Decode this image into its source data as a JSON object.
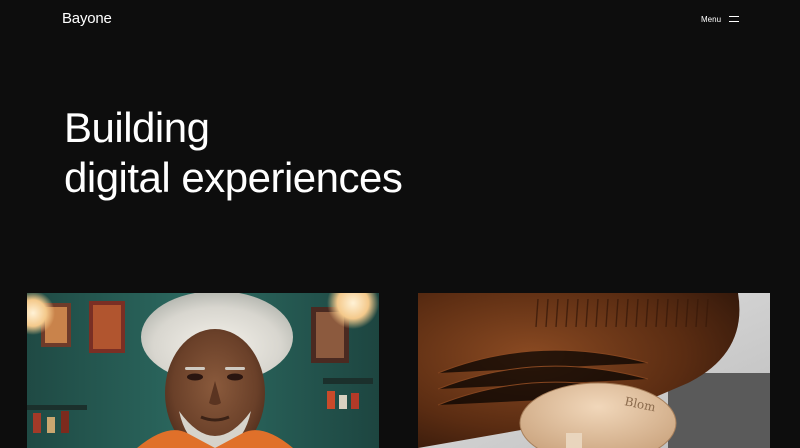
{
  "header": {
    "logo": "Bayone",
    "menu_label": "Menu",
    "menu_icon": "hamburger-icon"
  },
  "hero": {
    "line1": "Building",
    "line2": "digital experiences"
  },
  "projects": [
    {
      "image": "portrait-man-white-hair-teal-room"
    },
    {
      "image": "brown-speaker-product-closeup",
      "engraving": "Blom"
    }
  ]
}
